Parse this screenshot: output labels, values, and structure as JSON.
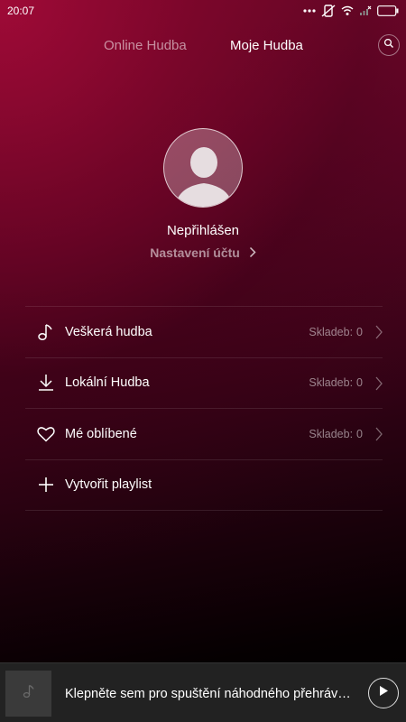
{
  "status_bar": {
    "time": "20:07"
  },
  "header": {
    "tabs": [
      {
        "label": "Online Hudba",
        "active": false
      },
      {
        "label": "Moje Hudba",
        "active": true
      }
    ],
    "search_icon": "search-icon"
  },
  "profile": {
    "name": "Nepřihlášen",
    "account_link": "Nastavení účtu"
  },
  "list": {
    "items": [
      {
        "icon": "music-note-icon",
        "label": "Veškerá hudba",
        "count_label": "Skladeb:",
        "count": "0"
      },
      {
        "icon": "download-icon",
        "label": "Lokální Hudba",
        "count_label": "Skladeb:",
        "count": "0"
      },
      {
        "icon": "heart-icon",
        "label": "Mé oblíbené",
        "count_label": "Skladeb:",
        "count": "0"
      },
      {
        "icon": "plus-icon",
        "label": "Vytvořit playlist"
      }
    ]
  },
  "player": {
    "text": "Klepněte sem pro spuštění náhodného přehrávání",
    "play_icon": "play-icon"
  },
  "colors": {
    "accent_top": "#8a0a34",
    "background_bottom": "#000000",
    "player_bar": "#222222"
  }
}
